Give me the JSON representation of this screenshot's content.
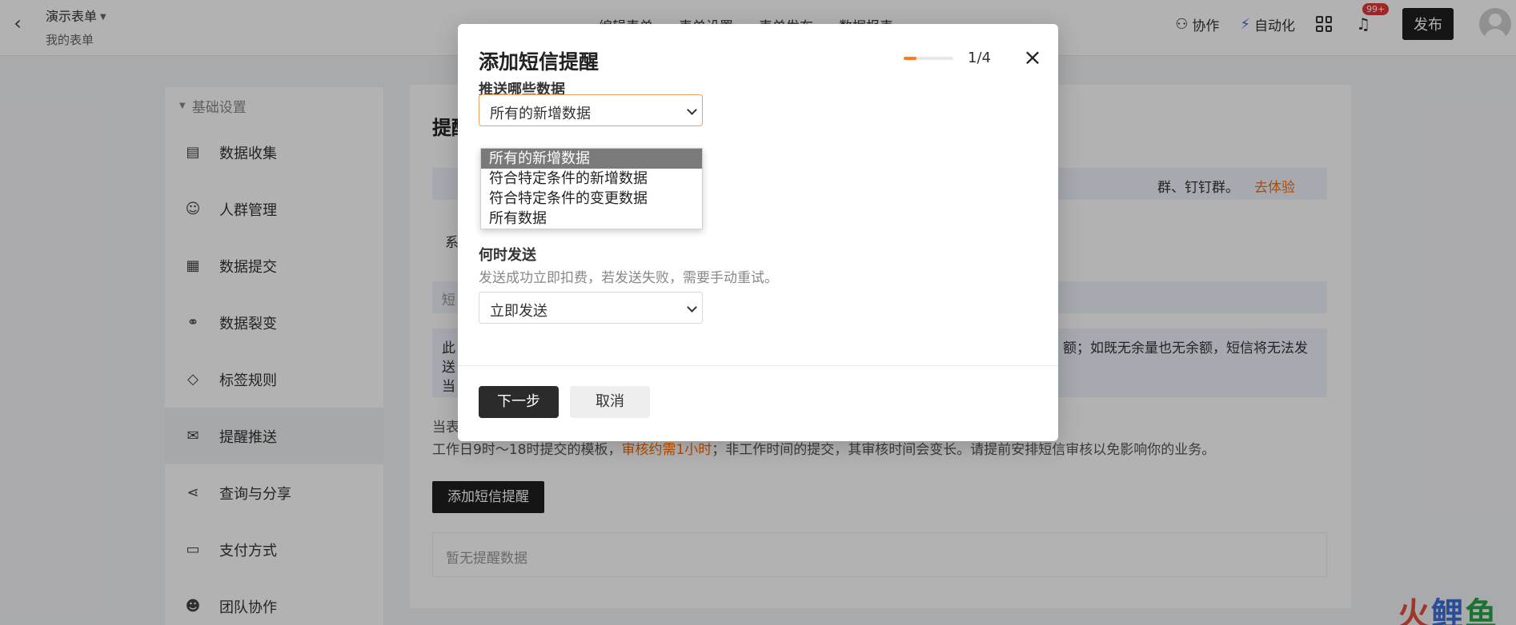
{
  "topbar": {
    "back_icon": "chevron-left-icon",
    "form_title": "演示表单",
    "form_subtitle": "我的表单",
    "tabs": [
      "编辑表单",
      "表单设置",
      "表单发布",
      "数据报表"
    ],
    "collab_label": "协作",
    "automation_label": "自动化",
    "notification_count": "99+",
    "publish_label": "发布"
  },
  "sidebar": {
    "section_label": "基础设置",
    "items": [
      {
        "label": "数据收集",
        "icon": "document-icon"
      },
      {
        "label": "人群管理",
        "icon": "users-icon"
      },
      {
        "label": "数据提交",
        "icon": "submit-icon"
      },
      {
        "label": "数据裂变",
        "icon": "share-nodes-icon"
      },
      {
        "label": "标签规则",
        "icon": "tag-icon"
      },
      {
        "label": "提醒推送",
        "icon": "send-icon"
      },
      {
        "label": "查询与分享",
        "icon": "share-icon"
      },
      {
        "label": "支付方式",
        "icon": "wallet-icon"
      },
      {
        "label": "团队协作",
        "icon": "team-icon"
      }
    ]
  },
  "main": {
    "title_fragment": "提醒",
    "info_tail": "群、钉钉群。",
    "info_link": "去体验",
    "sys_fragment": "系",
    "bar2_fragment": "短",
    "notice_l1": "此",
    "notice_l2": "送",
    "notice_l3": "当",
    "notice_tail": "额；如既无余量也无余额，短信将无法发",
    "note1_fragment": "当表",
    "note2_pre": "工作日9时～18时提交的模板，",
    "note2_warn": "审核约需1小时",
    "note2_post": "；非工作时间的提交，其审核时间会变长。请提前安排短信审核以免影响你的业务。",
    "add_button": "添加短信提醒",
    "empty_text": "暂无提醒数据"
  },
  "modal": {
    "title": "添加短信提醒",
    "progress_fraction": 0.25,
    "step": "1/4",
    "close_icon": "close-icon",
    "field1": {
      "label": "推送哪些数据",
      "value": "所有的新增数据",
      "options": [
        "所有的新增数据",
        "符合特定条件的新增数据",
        "符合特定条件的变更数据",
        "所有数据"
      ]
    },
    "field2": {
      "label": "何时发送",
      "hint": "发送成功立即扣费，若发送失败，需要手动重试。",
      "value": "立即发送"
    },
    "next_label": "下一步",
    "cancel_label": "取消"
  },
  "watermark": {
    "c1": "火",
    "c2": "鲤",
    "c3": "鱼"
  }
}
